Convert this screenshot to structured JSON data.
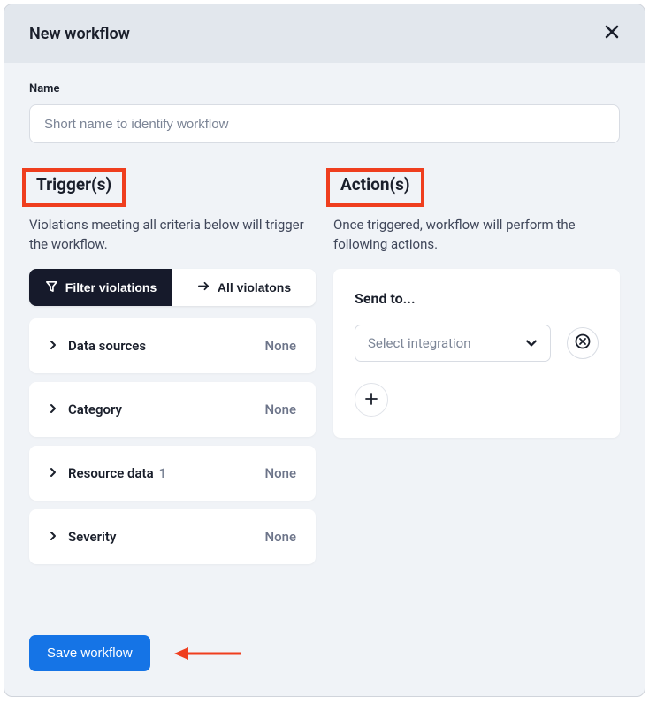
{
  "header": {
    "title": "New workflow"
  },
  "nameField": {
    "label": "Name",
    "placeholder": "Short name to identify workflow",
    "value": ""
  },
  "triggers": {
    "heading": "Trigger(s)",
    "description": "Violations meeting all criteria below will trigger the workflow.",
    "tabs": {
      "filter": "Filter violations",
      "all": "All violatons"
    },
    "filters": [
      {
        "label": "Data sources",
        "count": "",
        "value": "None"
      },
      {
        "label": "Category",
        "count": "",
        "value": "None"
      },
      {
        "label": "Resource data",
        "count": "1",
        "value": "None"
      },
      {
        "label": "Severity",
        "count": "",
        "value": "None"
      }
    ]
  },
  "actions": {
    "heading": "Action(s)",
    "description": "Once triggered, workflow will perform the following actions.",
    "sendTo": {
      "title": "Send to...",
      "selectPlaceholder": "Select integration"
    }
  },
  "footer": {
    "saveLabel": "Save workflow"
  }
}
